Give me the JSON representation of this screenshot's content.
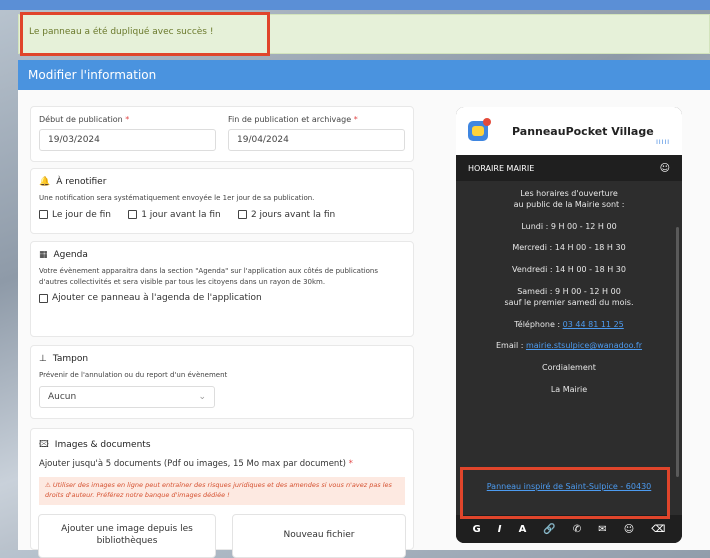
{
  "notification": {
    "message": "Le panneau a été dupliqué avec succès !"
  },
  "modal": {
    "title": "Modifier l'information"
  },
  "dates": {
    "start_label": "Début de publication",
    "start_value": "19/03/2024",
    "end_label": "Fin de publication et archivage",
    "end_value": "19/04/2024",
    "required_mark": "*"
  },
  "renotify": {
    "title": "À renotifier",
    "description": "Une notification sera systématiquement envoyée le 1er jour de sa publication.",
    "options": [
      "Le jour de fin",
      "1 jour avant la fin",
      "2 jours avant la fin"
    ]
  },
  "agenda": {
    "title": "Agenda",
    "description": "Votre évènement apparaitra dans la section \"Agenda\" sur l'application aux côtés de publications d'autres collectivités et sera visible par tous les citoyens dans un rayon de 30km.",
    "checkbox_label": "Ajouter ce panneau à l'agenda de l'application"
  },
  "stamp": {
    "title": "Tampon",
    "description": "Prévenir de l'annulation ou du report d'un évènement",
    "select_value": "Aucun"
  },
  "media": {
    "title": "Images & documents",
    "subtitle": "Ajouter jusqu'à 5 documents (Pdf ou images, 15 Mo max par document)",
    "required_mark": "*",
    "warning": "Utiliser des images en ligne peut entraîner des risques juridiques et des amendes si vous n'avez pas les droits d'auteur. Préférez notre banque d'images dédiée !",
    "library_button": "Ajouter une image depuis les bibliothèques",
    "new_file_button": "Nouveau fichier"
  },
  "preview": {
    "app_name": "PanneauPocket Village",
    "app_subtitle": "IIIII",
    "header": "HORAIRE MAIRIE",
    "lines": [
      "Les horaires d'ouverture",
      "au public de la Mairie sont :",
      "Lundi : 9 H 00 - 12 H 00",
      "Mercredi : 14 H 00 - 18 H 30",
      "Vendredi : 14 H 00 - 18 H 30",
      "Samedi : 9 H 00 - 12 H 00",
      "sauf le premier samedi du mois.",
      "Téléphone :",
      "03 44 81 11 25",
      "Email :",
      "mairie.stsulpice@wanadoo.fr",
      "Cordialement",
      "La Mairie"
    ],
    "footer_link": "Panneau inspiré de Saint-Sulpice - 60430",
    "toolbar": [
      "G",
      "I",
      "A"
    ]
  },
  "colors": {
    "accent": "#4a93df",
    "highlight": "#e0452b",
    "success_bg": "#e6f1d9"
  }
}
